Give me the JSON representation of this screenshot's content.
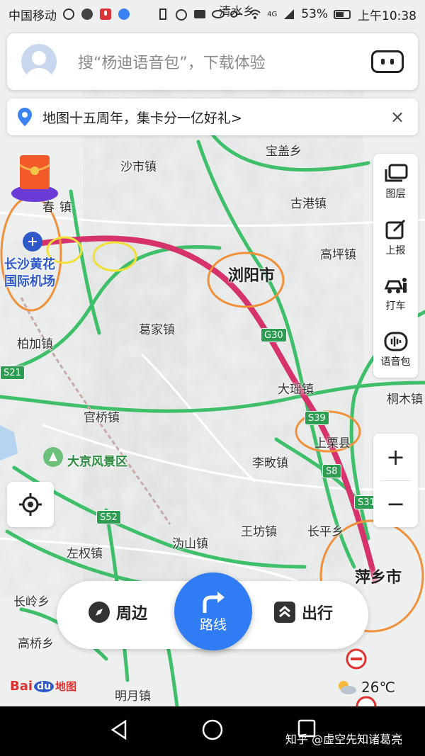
{
  "status_bar": {
    "carrier": "中国移动",
    "battery": "53%",
    "network": "4G",
    "time": "上午10:38"
  },
  "search": {
    "placeholder": "搜“杨迪语音包”，下载体验"
  },
  "notice": {
    "text": "地图十五周年，集卡分一亿好礼>",
    "close_label": "×"
  },
  "tools": [
    {
      "id": "layers",
      "label": "图层",
      "icon": "layers-icon"
    },
    {
      "id": "report",
      "label": "上报",
      "icon": "edit-icon"
    },
    {
      "id": "taxi",
      "label": "打车",
      "icon": "taxi-icon"
    },
    {
      "id": "voice",
      "label": "语音包",
      "icon": "voice-pack-icon"
    }
  ],
  "zoom": {
    "in": "+",
    "out": "−"
  },
  "map_labels": {
    "shashi": "沙市镇",
    "baogai": "宝盖乡",
    "chun": "春",
    "zhen": "镇",
    "gugang": "古港镇",
    "gaoping": "高坪镇",
    "liuyang": "浏阳市",
    "airport": "长沙黄花\n国际机场",
    "gejia": "葛家镇",
    "bojia": "柏加镇",
    "dayao": "大瑶镇",
    "tongmu": "桐木镇",
    "guanqiao": "官桥镇",
    "shangli": "上栗县",
    "lizhen": "李畋镇",
    "dajing": "大京风景区",
    "wangfang": "王坊镇",
    "changping": "长平乡",
    "weishan": "沩山镇",
    "zuoquan": "左权镇",
    "pingxiang": "萍乡市",
    "changling": "长岭乡",
    "gaoqiao": "高桥乡",
    "mingyue": "明月镇",
    "qingshui": "清水乡"
  },
  "road_shields": {
    "s21": "S21",
    "g30": "G30",
    "s39": "S39",
    "s8": "S8",
    "s31": "S31",
    "s52": "S52"
  },
  "bottom_nav": {
    "nearby": "周边",
    "route": "路线",
    "travel": "出行"
  },
  "logo": {
    "bai": "Bai",
    "du": "du",
    "suffix": "地图"
  },
  "weather": {
    "temp": "26℃",
    "icon": "partly-cloudy-icon"
  },
  "watermark": "知乎 @虚空先知诸葛亮",
  "colors": {
    "route_line": "#d6336c",
    "highlight_orange": "#f0903a",
    "highlight_yellow": "#f2e03a",
    "accent_blue": "#2f7cf4",
    "road_green": "#3fbf6a"
  }
}
